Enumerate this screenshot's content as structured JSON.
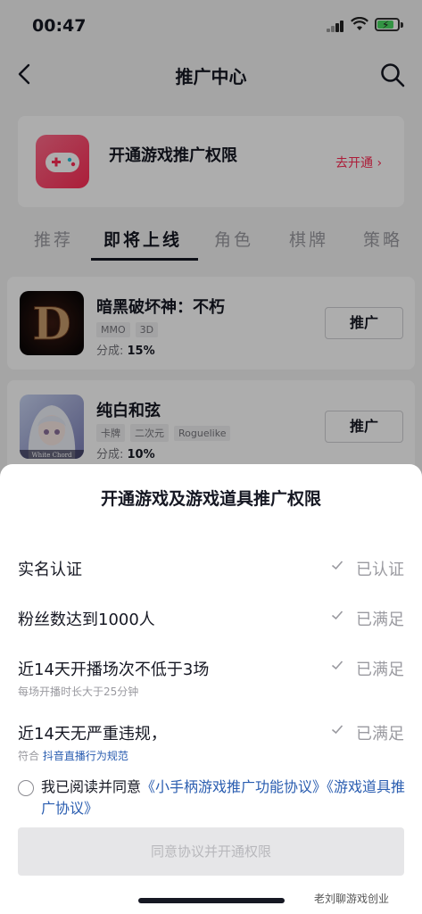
{
  "status_bar": {
    "time": "00:47"
  },
  "nav": {
    "title": "推广中心"
  },
  "promo": {
    "title": "开通游戏推广权限",
    "action": "去开通 ›"
  },
  "tabs": [
    "推荐",
    "即将上线",
    "角色",
    "棋牌",
    "策略"
  ],
  "games": [
    {
      "name": "暗黑破坏神：不朽",
      "tags": [
        "MMO",
        "3D"
      ],
      "share_label": "分成: ",
      "share_value": "15%",
      "button": "推广"
    },
    {
      "name": "纯白和弦",
      "tags": [
        "卡牌",
        "二次元",
        "Roguelike"
      ],
      "share_label": "分成: ",
      "share_value": "10%",
      "button": "推广"
    }
  ],
  "sheet": {
    "title": "开通游戏及游戏道具推广权限",
    "requirements": [
      {
        "label": "实名认证",
        "status": "已认证"
      },
      {
        "label": "粉丝数达到1000人",
        "status": "已满足"
      },
      {
        "label": "近14天开播场次不低于3场",
        "sub": "每场开播时长大于25分钟",
        "status": "已满足"
      },
      {
        "label": "近14天无严重违规，",
        "sub_prefix": "符合 ",
        "sub_link": "抖音直播行为规范",
        "status": "已满足"
      }
    ],
    "agree_prefix": "我已阅读并同意",
    "agree_link1": "《小手柄游戏推广功能协议》",
    "agree_link2": "《游戏道具推广协议》",
    "confirm_button": "同意协议并开通权限",
    "watermark": "老刘聊游戏创业"
  },
  "colors": {
    "accent": "#fe2c55",
    "link": "#2a5db0"
  }
}
